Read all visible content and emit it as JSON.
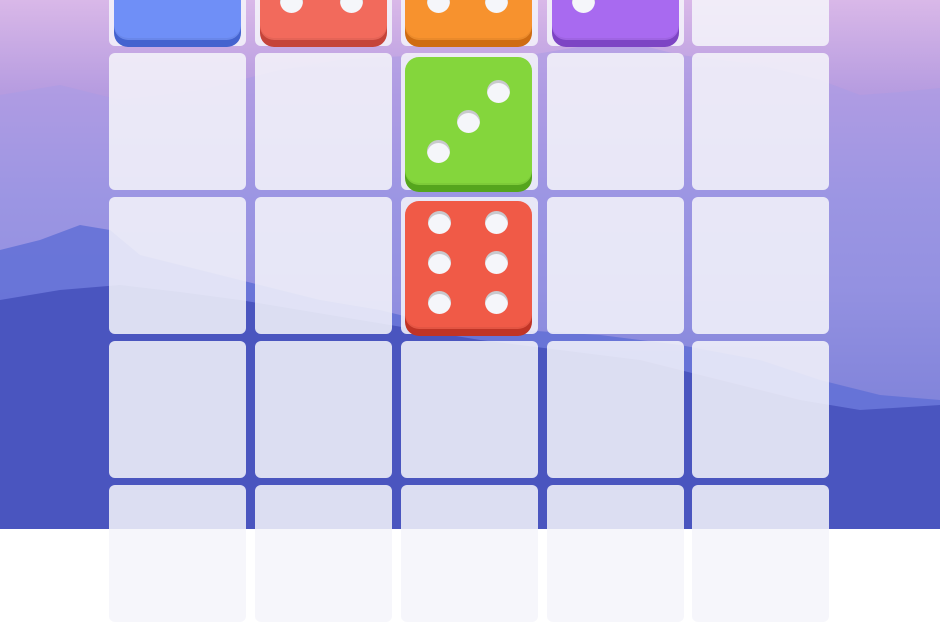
{
  "game": {
    "board": {
      "columns": 5,
      "rows": 5,
      "cell_color": "#f5f5fa"
    },
    "dice": [
      {
        "name": "die-blue",
        "color": "#6f8ff7",
        "shade": "#4463cf",
        "value": null,
        "pips_visible": 0
      },
      {
        "name": "die-red-top",
        "color": "#f26a5c",
        "shade": "#c5443a",
        "value": null,
        "pips_visible": 2
      },
      {
        "name": "die-orange",
        "color": "#f7922e",
        "shade": "#cf6c12",
        "value": null,
        "pips_visible": 2
      },
      {
        "name": "die-purple",
        "color": "#a86af0",
        "shade": "#7d45c4",
        "value": null,
        "pips_visible": 1
      },
      {
        "name": "die-green",
        "color": "#84d63c",
        "shade": "#55a51d",
        "value": 3,
        "pips_visible": 3
      },
      {
        "name": "die-red",
        "color": "#f05a47",
        "shade": "#c03426",
        "value": 6,
        "pips_visible": 6
      }
    ],
    "background": {
      "sky_top": "#e3b9ec",
      "sky_bottom": "#4b57c2",
      "mountain": "#4a55bf"
    }
  }
}
